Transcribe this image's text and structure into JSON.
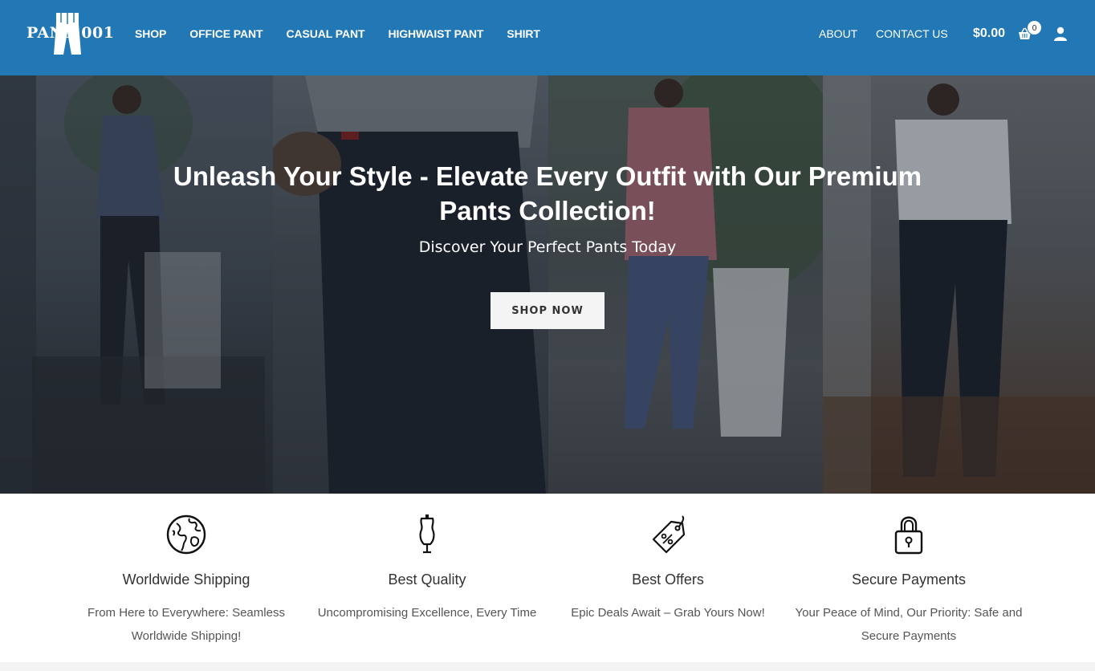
{
  "brand": {
    "logo_text": "PANT 001"
  },
  "nav": {
    "items": [
      {
        "label": "SHOP"
      },
      {
        "label": "OFFICE PANT"
      },
      {
        "label": "CASUAL PANT"
      },
      {
        "label": "HIGHWAIST PANT"
      },
      {
        "label": "SHIRT"
      }
    ],
    "about": "ABOUT",
    "contact": "CONTACT US"
  },
  "cart": {
    "total": "$0.00",
    "count": "0"
  },
  "hero": {
    "title": "Unleash Your Style - Elevate Every Outfit with Our Premium Pants Collection!",
    "subtitle": "Discover Your Perfect Pants Today",
    "button_label": "SHOP NOW"
  },
  "features": [
    {
      "icon": "globe-icon",
      "title": "Worldwide Shipping",
      "desc": "From Here to Everywhere: Seamless Worldwide Shipping!"
    },
    {
      "icon": "mannequin-icon",
      "title": "Best Quality",
      "desc": "Uncompromising Excellence, Every Time"
    },
    {
      "icon": "discount-tag-icon",
      "title": "Best Offers",
      "desc": "Epic Deals Await – Grab Yours Now!"
    },
    {
      "icon": "padlock-icon",
      "title": "Secure Payments",
      "desc": "Your Peace of Mind, Our Priority: Safe and Secure Payments"
    }
  ],
  "colors": {
    "header_bg": "#2278b5",
    "text_white": "#ffffff",
    "button_bg": "#f4f4f4"
  }
}
